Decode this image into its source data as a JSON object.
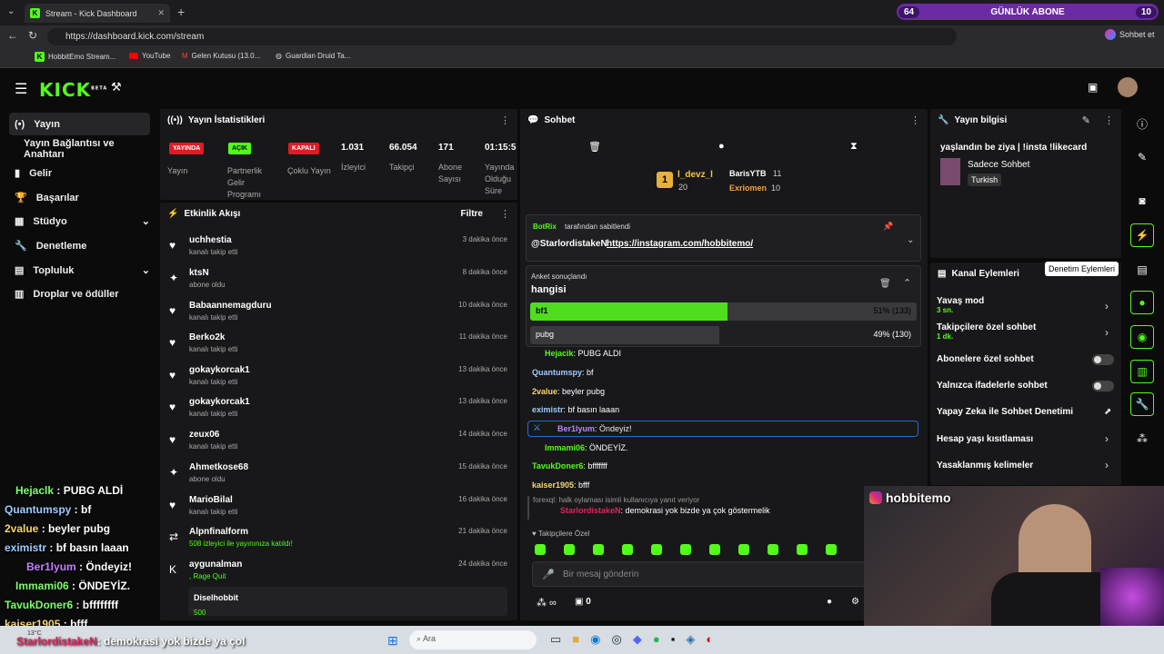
{
  "browser": {
    "tab_title": "Stream - Kick Dashboard",
    "url": "https://dashboard.kick.com/stream",
    "goal_label": "GÜNLÜK ABONE",
    "goal_current": "64",
    "goal_target": "10",
    "profile_label": "Sohbet et",
    "bookmarks": [
      "HobbitEmo Stream...",
      "YouTube",
      "Gelen Kutusu (13.0...",
      "Guardian Druid Ta..."
    ]
  },
  "logo": "KICK",
  "logo_tag": "BETA",
  "sidebar": {
    "items": [
      {
        "label": "Yayın",
        "icon": "(•)"
      },
      {
        "label": "Yayın Bağlantısı ve Anahtarı",
        "icon": ""
      },
      {
        "label": "Gelir",
        "icon": "▮"
      },
      {
        "label": "Başarılar",
        "icon": "🏆"
      },
      {
        "label": "Stüdyo",
        "icon": "▦"
      },
      {
        "label": "Denetleme",
        "icon": "🔧"
      },
      {
        "label": "Topluluk",
        "icon": "▤"
      },
      {
        "label": "Droplar ve ödüller",
        "icon": "▥"
      }
    ]
  },
  "stats": {
    "title": "Yayın İstatistikleri",
    "badges": [
      {
        "text": "YAYINDA",
        "label": "Yayın"
      },
      {
        "text": "AÇIK",
        "label": "Partnerlik Gelir Programı"
      },
      {
        "text": "KAPALI",
        "label": "Çoklu Yayın"
      }
    ],
    "values": [
      {
        "value": "1.031",
        "label": "İzleyici"
      },
      {
        "value": "66.054",
        "label": "Takipçi"
      },
      {
        "value": "171",
        "label": "Abone Sayısı"
      },
      {
        "value": "01:15:5",
        "label": "Yayında Olduğu Süre"
      }
    ]
  },
  "activity": {
    "title": "Etkinlik Akışı",
    "filter": "Filtre",
    "events": [
      {
        "name": "uchhestia",
        "desc": "kanalı takip etti",
        "time": "3 dakika önce",
        "icon": "♥"
      },
      {
        "name": "ktsN",
        "desc": "abone oldu",
        "time": "8 dakika önce",
        "icon": "✦"
      },
      {
        "name": "Babaannemagduru",
        "desc": "kanalı takip etti",
        "time": "10 dakika önce",
        "icon": "♥"
      },
      {
        "name": "Berko2k",
        "desc": "kanalı takip etti",
        "time": "11 dakika önce",
        "icon": "♥"
      },
      {
        "name": "gokaykorcak1",
        "desc": "kanalı takip etti",
        "time": "13 dakika önce",
        "icon": "♥"
      },
      {
        "name": "gokaykorcak1",
        "desc": "kanalı takip etti",
        "time": "13 dakika önce",
        "icon": "♥"
      },
      {
        "name": "zeux06",
        "desc": "kanalı takip etti",
        "time": "14 dakika önce",
        "icon": "♥"
      },
      {
        "name": "Ahmetkose68",
        "desc": "abone oldu",
        "time": "15 dakika önce",
        "icon": "✦"
      },
      {
        "name": "MarioBilal",
        "desc": "kanalı takip etti",
        "time": "16 dakika önce",
        "icon": "♥"
      },
      {
        "name": "Alpnfinalform",
        "desc": "508 izleyici ile yayınınıza katıldı!",
        "time": "21 dakika önce",
        "icon": "⇄"
      },
      {
        "name": "aygunalman",
        "desc": ", Rage Quit",
        "time": "24 dakika önce",
        "icon": "K"
      }
    ],
    "raid_name": "Diselhobbit",
    "raid_value": "500"
  },
  "chat": {
    "title": "Sohbet",
    "top1": {
      "name": "l_devz_l",
      "value": "20"
    },
    "top2": {
      "name": "BarisYTB",
      "value": "11"
    },
    "top3": {
      "name": "Exriomen",
      "value": "10"
    },
    "rank": "1",
    "pinned_by": "BotRix",
    "pinned_suffix": "tarafından sabitlendi",
    "pinned_user": "@StarlordistakeN",
    "pinned_link": "https://instagram.com/hobbitemo/",
    "poll_status": "Anket sonuçlandı",
    "poll_question": "hangisi",
    "poll_options": [
      {
        "label": "bf1",
        "result": "51% (133)",
        "fraction": 0.51
      },
      {
        "label": "pubg",
        "result": "49% (130)",
        "fraction": 0.49
      }
    ],
    "messages": [
      {
        "user": "Hejacik",
        "text": ": PUBG ALDI",
        "color": "#53fc18"
      },
      {
        "user": "Quantumspy",
        "text": ": bf",
        "color": "#9ecbff"
      },
      {
        "user": "2value",
        "text": ": beyler pubg",
        "color": "#f5d76e"
      },
      {
        "user": "eximistr",
        "text": ": bf basın laaan",
        "color": "#9ecbff"
      },
      {
        "user": "Ber1lyum",
        "text": ": Öndeyiz!",
        "color": "#b388ff"
      },
      {
        "user": "Immami06",
        "text": ": ÖNDEYİZ.",
        "color": "#53fc18"
      },
      {
        "user": "TavukDoner6",
        "text": ": bfffffff",
        "color": "#53fc18"
      },
      {
        "user": "kaiser1905",
        "text": ": bfff",
        "color": "#f5d76e"
      }
    ],
    "reply_note": "forexql: halk oylaması isimli kullanıcıya yanıt veriyor",
    "reply_user": "StarlordistakeN",
    "reply_text": ": demokrasi yok bizde ya çok göstermelik",
    "followers_label": "Takipçilere Özel",
    "input_placeholder": "Bir mesaj gönderin",
    "bottom_count": "0"
  },
  "info": {
    "title": "Yayın bilgisi",
    "stream_title": "yaşlandın be ziya | !insta !likecard",
    "category": "Sadece Sohbet",
    "language": "Turkish"
  },
  "actions": {
    "title": "Kanal Eylemleri",
    "tooltip": "Denetim Eylemleri",
    "items": [
      {
        "label": "Yavaş mod",
        "sub": "3 sn.",
        "kind": "chev"
      },
      {
        "label": "Takipçilere özel sohbet",
        "sub": "1 dk.",
        "kind": "chev"
      },
      {
        "label": "Abonelere özel sohbet",
        "sub": "",
        "kind": "toggle"
      },
      {
        "label": "Yalnızca ifadelerle sohbet",
        "sub": "",
        "kind": "toggle"
      },
      {
        "label": "Yapay Zeka ile Sohbet Denetimi",
        "sub": "",
        "kind": "ext"
      },
      {
        "label": "Hesap yaşı kısıtlaması",
        "sub": "",
        "kind": "chev"
      },
      {
        "label": "Yasaklanmış kelimeler",
        "sub": "",
        "kind": "chev"
      }
    ]
  },
  "webcam": {
    "handle": "hobbitemo"
  },
  "overlay": {
    "lines": [
      {
        "user": "Hejaclk",
        "text": " : PUBG ALDİ",
        "color": "#7dff6a"
      },
      {
        "user": "Quantumspy",
        "text": " : bf",
        "color": "#9ecbff"
      },
      {
        "user": "2value",
        "text": " : beyler pubg",
        "color": "#f5d76e"
      },
      {
        "user": "eximistr",
        "text": " : bf basın laaan",
        "color": "#9ecbff"
      },
      {
        "user": "Ber1lyum",
        "text": " : Öndeyiz!",
        "color": "#c77dff"
      },
      {
        "user": "Immami06",
        "text": " : ÖNDEYİZ.",
        "color": "#7dff6a"
      },
      {
        "user": "TavukDoner6",
        "text": " : bffffffff",
        "color": "#7dff6a"
      },
      {
        "user": "kaiser1905",
        "text": " : bfff",
        "color": "#f5d76e"
      }
    ],
    "last_user": "StarlordistakeN",
    "last_text": ": demokrasi yok bizde ya çol"
  },
  "taskbar": {
    "search": "Ara",
    "temp": "13°C"
  }
}
